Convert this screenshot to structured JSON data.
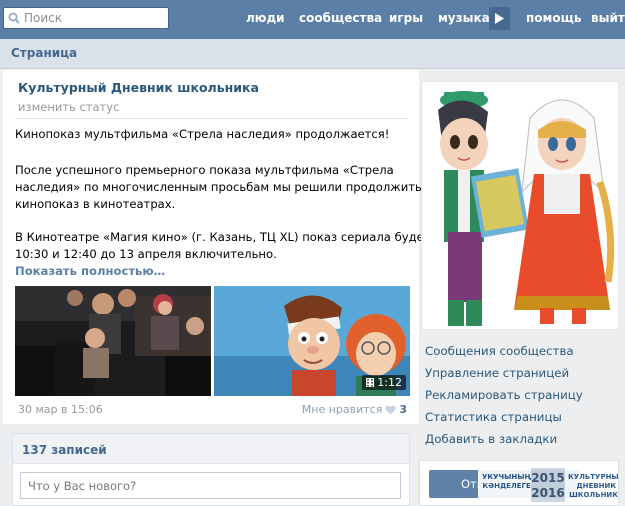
{
  "topbar": {
    "search_placeholder": "Поиск",
    "links": [
      "люди",
      "сообщества",
      "игры",
      "музыка",
      "помощь",
      "выйти"
    ]
  },
  "page_header": {
    "title": "Страница"
  },
  "post": {
    "community_name": "Культурный Дневник школьника",
    "change_status": "изменить статус",
    "lines": [
      "Кинопоказ мультфильма «Стрела наследия» продолжается!",
      "После успешного премьерного показа мультфильма «Стрела",
      "наследия» по многочисленным просьбам мы решили продолжить",
      "кинопоказ в кинотеатрах.",
      "В Кинотеатре «Магия кино» (г. Казань, ТЦ XL) показ сериала будет в",
      "10:30 и 12:40 до 13 апреля включительно."
    ],
    "show_more": "Показать полностью…",
    "video_duration": "1:12",
    "date": "30 мар в 15:06",
    "like_label": "Мне нравится",
    "like_count": "3"
  },
  "records": {
    "count_label": "137 записей",
    "new_post_placeholder": "Что у Вас нового?"
  },
  "sidebar": {
    "links": [
      "Сообщения сообщества",
      "Управление страницей",
      "Рекламировать страницу",
      "Статистика страницы",
      "Добавить в закладки"
    ],
    "send_button": "Отправить",
    "banner_left": [
      "УКУЧЫНЫҢ",
      "КӘНДЕЛЕГЕ"
    ],
    "banner_years": [
      "2015",
      "2016"
    ],
    "banner_right": [
      "КУЛЬТУРНЫЙ",
      "ДНЕВНИК",
      "ШКОЛЬНИКА"
    ]
  },
  "colors": {
    "header_blue": "#5b7fa6",
    "link_blue": "#2b587a",
    "page_bg": "#edeef0"
  }
}
